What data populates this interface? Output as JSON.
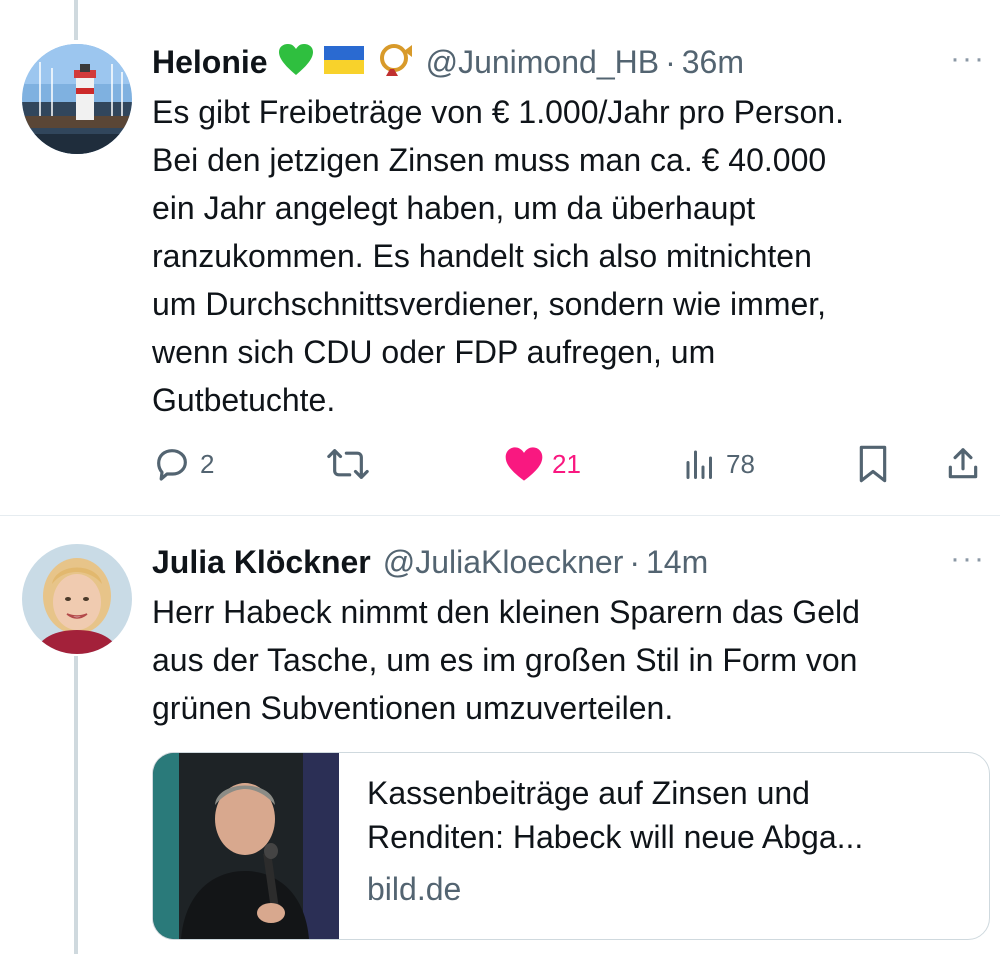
{
  "tweets": [
    {
      "name": "Helonie",
      "emojis": [
        "green-heart",
        "ukraine-flag",
        "postal-horn"
      ],
      "handle": "@Junimond_HB",
      "dot": "·",
      "time": "36m",
      "more": "···",
      "lines": [
        "Es gibt Freibeträge von € 1.000/Jahr pro Person.",
        "Bei den jetzigen Zinsen muss man ca. € 40.000",
        "ein Jahr angelegt haben, um da überhaupt",
        "ranzukommen. Es handelt sich also mitnichten",
        "um Durchschnittsverdiener, sondern wie immer,",
        "wenn sich CDU oder FDP aufregen, um",
        "Gutbetuchte."
      ],
      "replies": "2",
      "likes": "21",
      "views": "78",
      "liked": true
    },
    {
      "name": "Julia Klöckner",
      "handle": "@JuliaKloeckner",
      "dot": "·",
      "time": "14m",
      "more": "···",
      "lines": [
        "Herr Habeck nimmt den kleinen Sparern das Geld",
        "aus der Tasche, um es im großen Stil in Form von",
        "grünen Subventionen umzuverteilen."
      ],
      "card": {
        "title_line1": "Kassenbeiträge auf Zinsen und",
        "title_line2": "Renditen: Habeck will neue Abga...",
        "domain": "bild.de"
      }
    }
  ],
  "colors": {
    "like_active": "#f91880",
    "text_secondary": "#536471",
    "thread_line": "#cfd9de"
  }
}
